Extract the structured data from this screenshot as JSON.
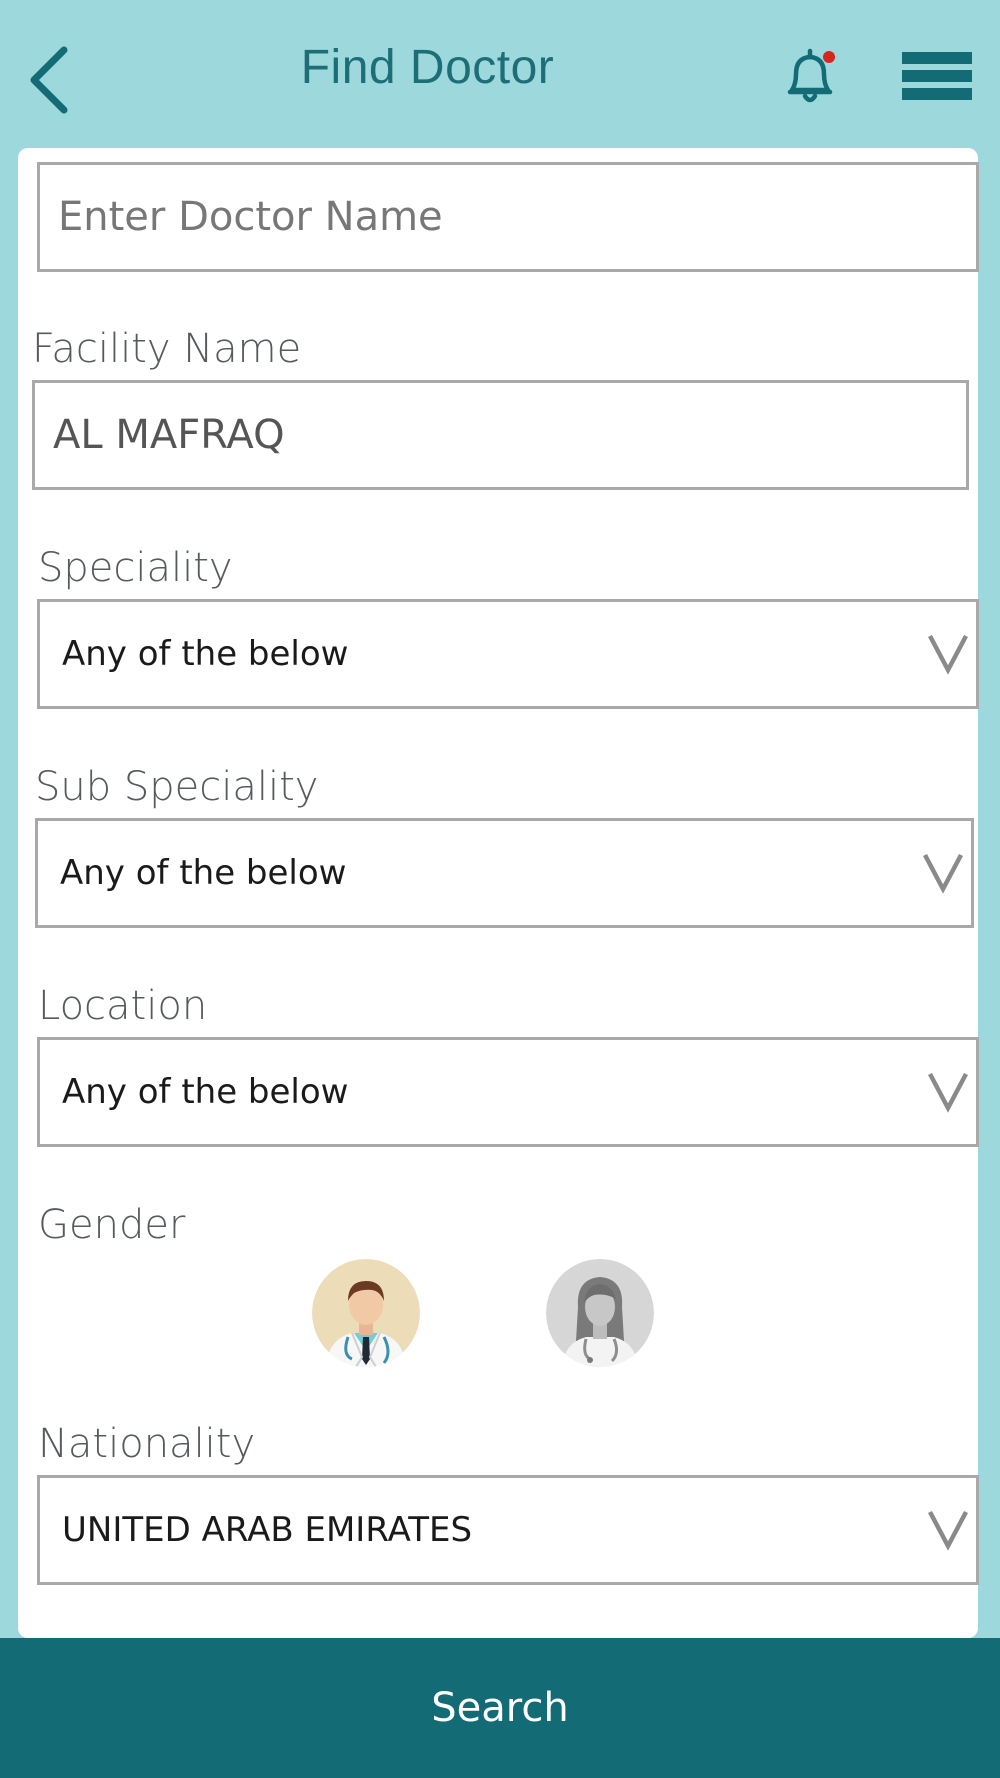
{
  "header": {
    "title": "Find Doctor"
  },
  "doctor_name": {
    "placeholder": "Enter Doctor Name",
    "value": ""
  },
  "facility": {
    "label": "Facility Name",
    "value": "AL MAFRAQ"
  },
  "speciality": {
    "label": "Speciality",
    "value": "Any of the below"
  },
  "sub_speciality": {
    "label": "Sub Speciality",
    "value": "Any of the below"
  },
  "location": {
    "label": "Location",
    "value": "Any of the below"
  },
  "gender": {
    "label": "Gender"
  },
  "nationality": {
    "label": "Nationality",
    "value": "UNITED ARAB EMIRATES"
  },
  "search_label": "Search",
  "colors": {
    "background": "#9dd8dc",
    "primary": "#136b75",
    "title": "#1e6e77",
    "notification_dot": "#d7261e"
  },
  "icons": {
    "back": "chevron-left-icon",
    "notifications": "bell-icon",
    "menu": "hamburger-menu-icon",
    "dropdown": "chevron-down-icon",
    "male": "male-doctor-avatar",
    "female": "female-doctor-avatar"
  }
}
